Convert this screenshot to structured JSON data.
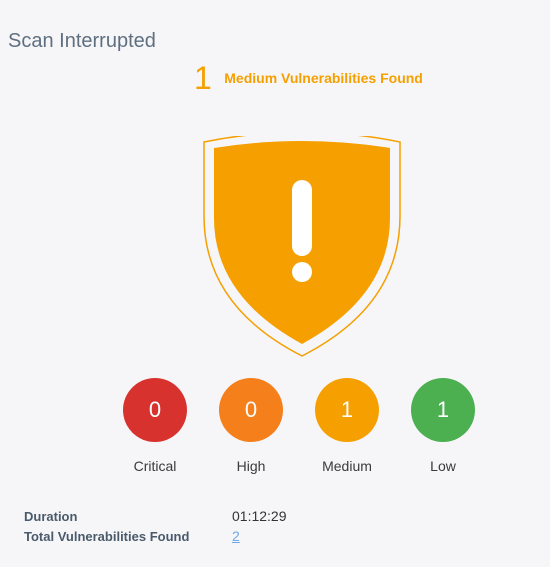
{
  "header": {
    "title": "Scan Interrupted"
  },
  "summary": {
    "count": "1",
    "label": "Medium Vulnerabilities Found",
    "color": "#F5A000",
    "icon": "shield-exclamation-icon"
  },
  "severities": [
    {
      "count": "0",
      "label": "Critical",
      "color": "#D8322E"
    },
    {
      "count": "0",
      "label": "High",
      "color": "#F47F1B"
    },
    {
      "count": "1",
      "label": "Medium",
      "color": "#F5A000"
    },
    {
      "count": "1",
      "label": "Low",
      "color": "#4CAF50"
    }
  ],
  "details": {
    "duration_label": "Duration",
    "duration_value": "01:12:29",
    "total_label": "Total Vulnerabilities Found",
    "total_value": "2"
  }
}
